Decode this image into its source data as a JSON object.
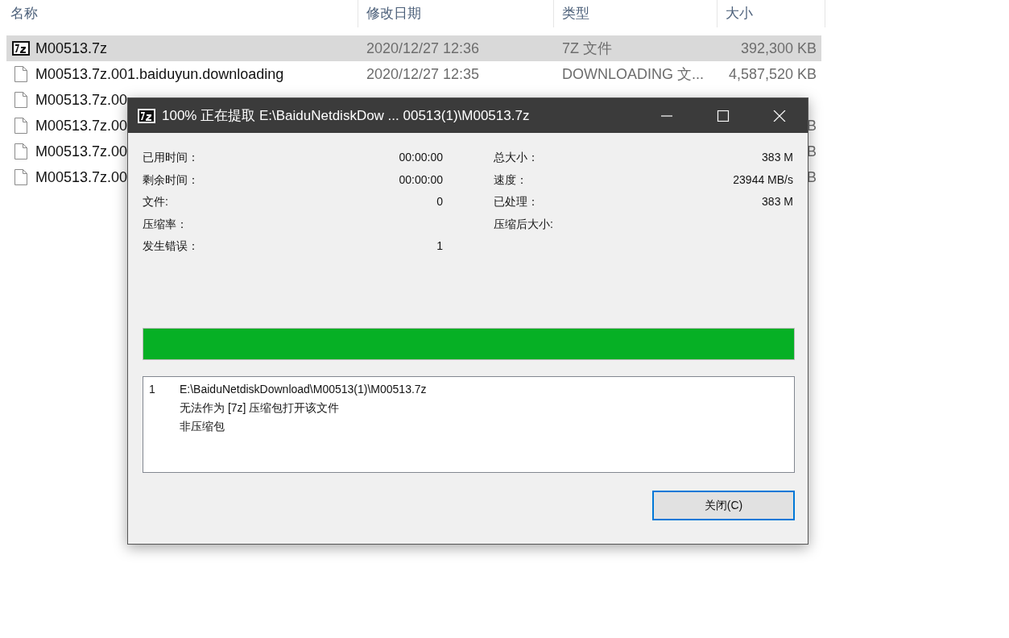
{
  "explorer": {
    "columns": [
      "名称",
      "修改日期",
      "类型",
      "大小"
    ],
    "rows": [
      {
        "kind": "archive",
        "selected": true,
        "name": "M00513.7z",
        "date": "2020/12/27 12:36",
        "type": "7Z 文件",
        "size": "392,300 KB"
      },
      {
        "kind": "file",
        "selected": false,
        "name": "M00513.7z.001.baiduyun.downloading",
        "date": "2020/12/27 12:35",
        "type": "DOWNLOADING 文...",
        "size": "4,587,520 KB"
      },
      {
        "kind": "file",
        "selected": false,
        "name": "M00513.7z.00"
      },
      {
        "kind": "file",
        "selected": false,
        "name": "M00513.7z.00",
        "size": "B"
      },
      {
        "kind": "file",
        "selected": false,
        "name": "M00513.7z.00",
        "size": "B"
      },
      {
        "kind": "file",
        "selected": false,
        "name": "M00513.7z.00",
        "size": "B"
      }
    ]
  },
  "dialog": {
    "title": "100% 正在提取 E:\\BaiduNetdiskDow ... 00513(1)\\M00513.7z",
    "stats_left": [
      {
        "label": "已用时间：",
        "value": "00:00:00"
      },
      {
        "label": "剩余时间：",
        "value": "00:00:00"
      },
      {
        "label": "文件:",
        "value": "0"
      },
      {
        "label": "压缩率："
      },
      {
        "label": "发生错误：",
        "value": "1"
      }
    ],
    "stats_right": [
      {
        "label": "总大小：",
        "value": "383 M"
      },
      {
        "label": "速度：",
        "value": "23944 MB/s"
      },
      {
        "label": "已处理：",
        "value": "383 M"
      },
      {
        "label": "压缩后大小:"
      }
    ],
    "progress": {
      "level": 1
    },
    "log": [
      {
        "index": "1",
        "lines": [
          "E:\\BaiduNetdiskDownload\\M00513(1)\\M00513.7z",
          "无法作为 [7z] 压缩包打开该文件",
          "非压缩包"
        ]
      }
    ],
    "close_button": "关闭(C)"
  }
}
